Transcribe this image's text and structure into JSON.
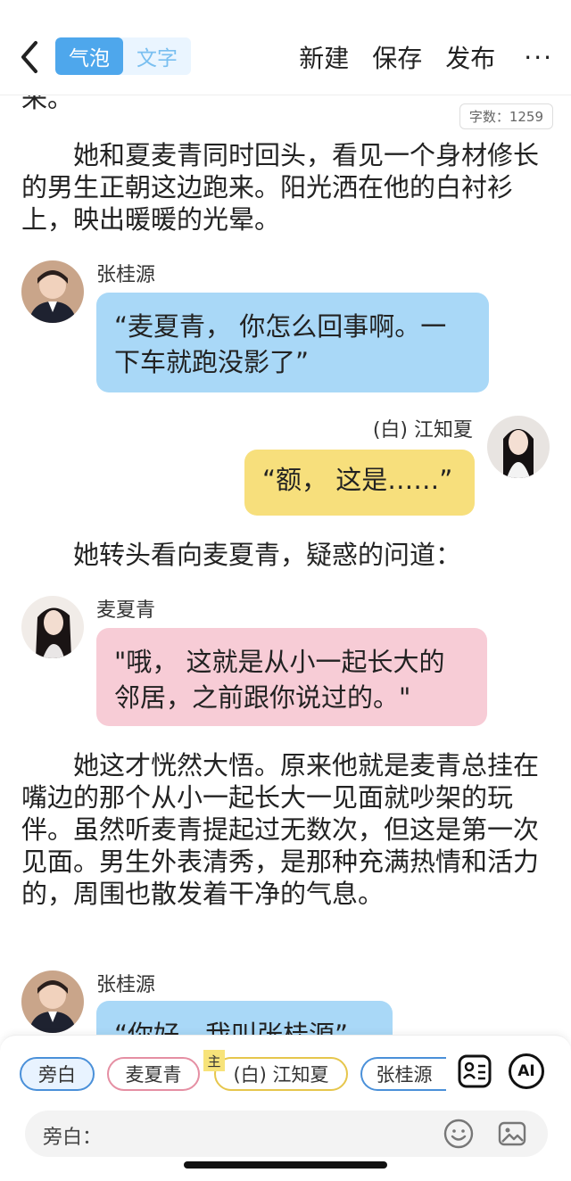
{
  "header": {
    "mode_bubble": "气泡",
    "mode_text": "文字",
    "actions": {
      "new": "新建",
      "save": "保存",
      "publish": "发布",
      "more": "···"
    }
  },
  "word_count": "字数：1259",
  "story": {
    "cut_line": "来。",
    "p1": "她和夏麦青同时回头，看见一个身材修长的男生正朝这边跑来。阳光洒在他的白衬衫上，映出暖暖的光晕。",
    "msg1": {
      "speaker": "张桂源",
      "text": "“麦夏青， 你怎么回事啊。一下车就跑没影了”"
    },
    "msg2": {
      "speaker": "(白) 江知夏",
      "text": "“额， 这是……”"
    },
    "p2": "她转头看向麦夏青，疑惑的问道：",
    "msg3": {
      "speaker": "麦夏青",
      "text": "\"哦， 这就是从小一起长大的邻居，之前跟你说过的。\""
    },
    "p3": "她这才恍然大悟。原来他就是麦青总挂在嘴边的那个从小一起长大一见面就吵架的玩伴。虽然听麦青提起过无数次，但这是第一次见面。男生外表清秀，是那种充满热情和活力的，周围也散发着干净的气息。",
    "msg4": {
      "speaker": "张桂源",
      "text": "“你好，我叫张桂源”"
    }
  },
  "panel": {
    "chips": [
      "旁白",
      "麦夏青",
      "(白) 江知夏",
      "张桂源"
    ],
    "main_badge": "主",
    "ai_label": "AI",
    "input_label": "旁白："
  },
  "colors": {
    "accent": "#4ea7ec",
    "blue_bubble": "#a9d8f7",
    "yellow_bubble": "#f7df7c",
    "pink_bubble": "#f7ccd6"
  }
}
